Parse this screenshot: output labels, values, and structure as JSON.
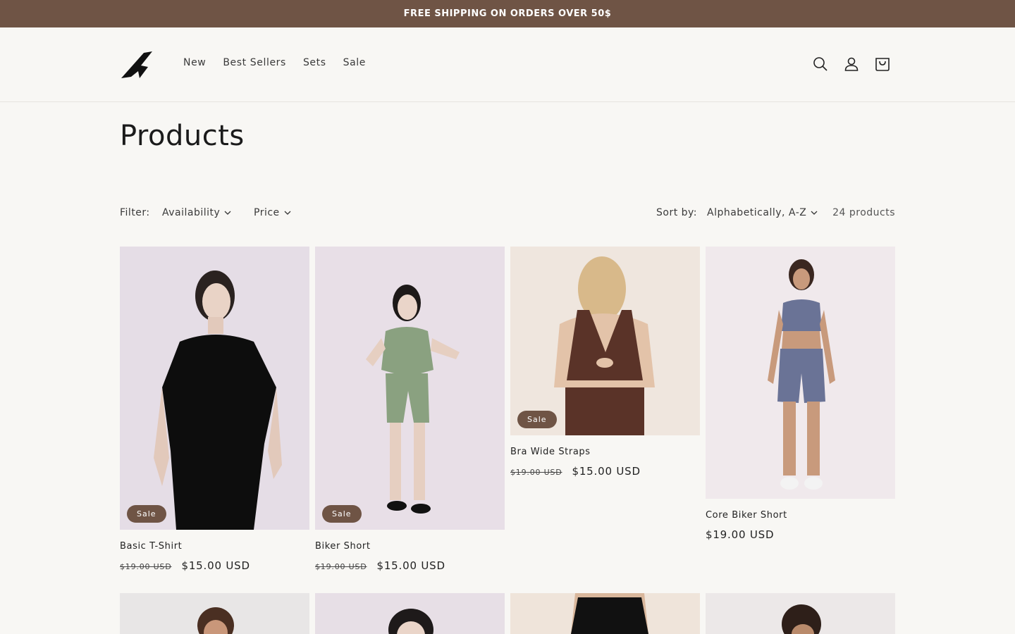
{
  "announcement": "FREE SHIPPING ON ORDERS OVER 50$",
  "nav": [
    "New",
    "Best Sellers",
    "Sets",
    "Sale"
  ],
  "header_icons": [
    "search-icon",
    "account-icon",
    "cart-icon"
  ],
  "page_title": "Products",
  "filter": {
    "label": "Filter:",
    "availability": "Availability",
    "price": "Price",
    "sort_label": "Sort by:",
    "sort_value": "Alphabetically, A-Z",
    "count": "24 products"
  },
  "sale_badge": "Sale",
  "products": [
    {
      "title": "Basic T-Shirt",
      "old_price": "$19.00 USD",
      "price": "$15.00 USD",
      "on_sale": true
    },
    {
      "title": "Biker Short",
      "old_price": "$19.00 USD",
      "price": "$15.00 USD",
      "on_sale": true
    },
    {
      "title": "Bra Wide Straps",
      "old_price": "$19.00 USD",
      "price": "$15.00 USD",
      "on_sale": true
    },
    {
      "title": "Core Biker Short",
      "old_price": "",
      "price": "$19.00 USD",
      "on_sale": false
    }
  ],
  "colors": {
    "accent": "#6f5445",
    "background": "#f8f7f4"
  }
}
